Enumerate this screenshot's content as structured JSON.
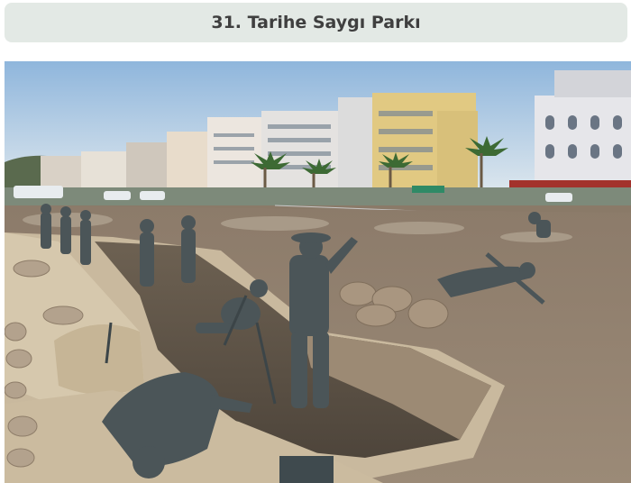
{
  "header": {
    "title": "31. Tarihe Saygı Parkı"
  },
  "photo": {
    "subject": "Historical Respect Park trench memorial with soldier statues"
  }
}
